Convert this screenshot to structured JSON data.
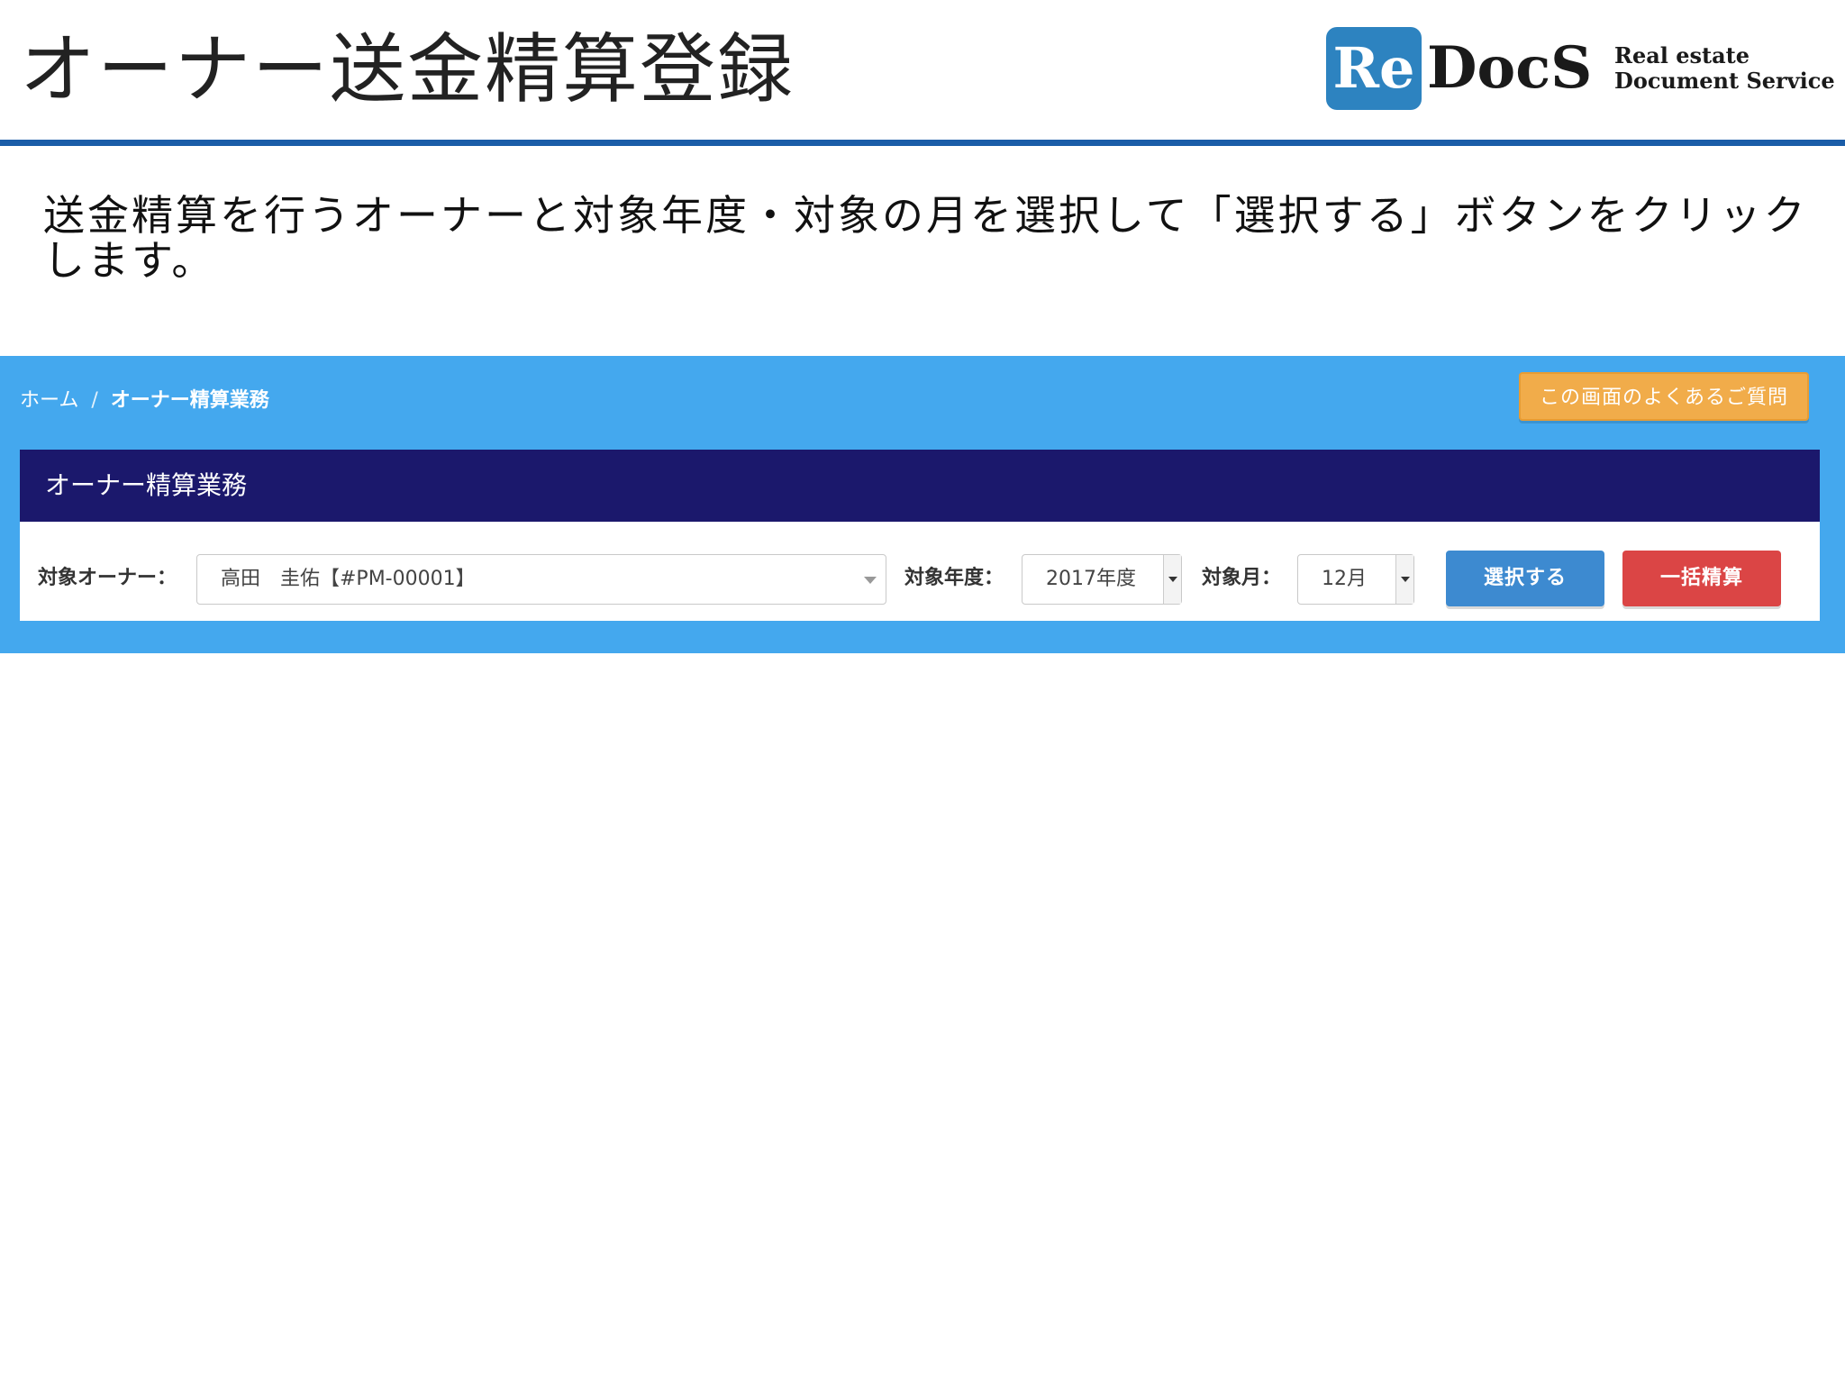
{
  "slide": {
    "title": "オーナー送金精算登録",
    "instruction": "送金精算を行うオーナーと対象年度・対象の月を選択して「選択する」ボタンをクリックします。"
  },
  "logo": {
    "mark": "Re",
    "name": "DocS",
    "tagline1": "Real estate",
    "tagline2": "Document Service",
    "brand_color": "#2d83c0"
  },
  "app": {
    "breadcrumb": {
      "home": "ホーム",
      "separator": "/",
      "current": "オーナー精算業務"
    },
    "faq_button": "この画面のよくあるご質問",
    "panel_title": "オーナー精算業務",
    "filters": {
      "owner_label": "対象オーナー：",
      "owner_value": "高田　圭佑【#PM-00001】",
      "year_label": "対象年度：",
      "year_value": "2017年度",
      "month_label": "対象月：",
      "month_value": "12月"
    },
    "buttons": {
      "select": "選択する",
      "bulk": "一括精算"
    },
    "colors": {
      "app_bg": "#44a8ee",
      "panel_header": "#1b186c",
      "faq": "#f1ac4a",
      "select_button": "#3d8ad0",
      "bulk_button": "#db4545"
    }
  }
}
